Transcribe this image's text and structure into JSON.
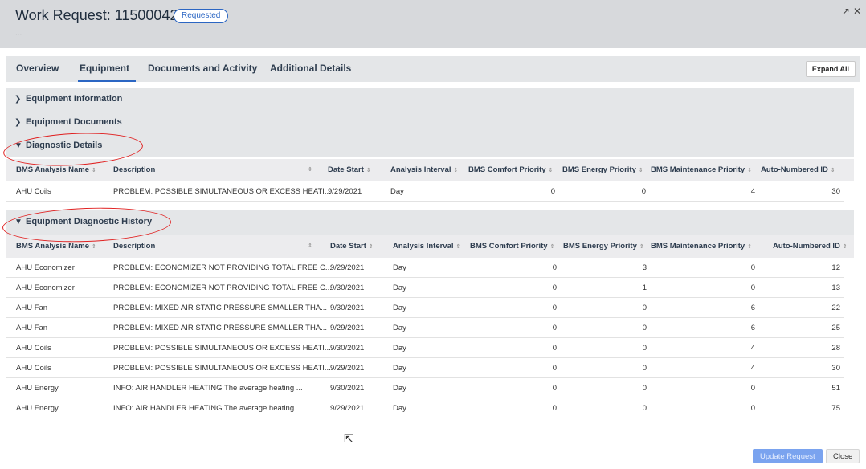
{
  "header": {
    "title": "Work Request: 1150004225",
    "status": "Requested",
    "subtitle": "...",
    "expand_icon": "↗",
    "close_icon": "✕"
  },
  "tabs": {
    "overview": "Overview",
    "equipment": "Equipment",
    "documents": "Documents and Activity",
    "additional": "Additional Details",
    "expand_all": "Expand All"
  },
  "sections": {
    "equipment_information": "Equipment Information",
    "equipment_documents": "Equipment Documents",
    "diagnostic_details": "Diagnostic Details",
    "diagnostic_history": "Equipment Diagnostic History"
  },
  "columns": {
    "name": "BMS Analysis Name",
    "description": "Description",
    "date_start": "Date Start",
    "interval": "Analysis Interval",
    "comfort": "BMS Comfort Priority",
    "energy": "BMS Energy Priority",
    "maintenance": "BMS Maintenance Priority",
    "id": "Auto-Numbered ID",
    "sort_icon": "⇕"
  },
  "diagnostic_rows": [
    {
      "name": "AHU Coils",
      "description": "PROBLEM: POSSIBLE SIMULTANEOUS OR EXCESS HEATI...",
      "date": "9/29/2021",
      "interval": "Day",
      "comfort": "0",
      "energy": "0",
      "maintenance": "4",
      "id": "30"
    }
  ],
  "history_rows": [
    {
      "name": "AHU Economizer",
      "description": "PROBLEM: ECONOMIZER NOT PROVIDING TOTAL FREE C...",
      "date": "9/29/2021",
      "interval": "Day",
      "comfort": "0",
      "energy": "3",
      "maintenance": "0",
      "id": "12"
    },
    {
      "name": "AHU Economizer",
      "description": "PROBLEM: ECONOMIZER NOT PROVIDING TOTAL FREE C...",
      "date": "9/30/2021",
      "interval": "Day",
      "comfort": "0",
      "energy": "1",
      "maintenance": "0",
      "id": "13"
    },
    {
      "name": "AHU Fan",
      "description": "PROBLEM: MIXED AIR STATIC PRESSURE SMALLER THA...",
      "date": "9/30/2021",
      "interval": "Day",
      "comfort": "0",
      "energy": "0",
      "maintenance": "6",
      "id": "22"
    },
    {
      "name": "AHU Fan",
      "description": "PROBLEM: MIXED AIR STATIC PRESSURE SMALLER THA...",
      "date": "9/29/2021",
      "interval": "Day",
      "comfort": "0",
      "energy": "0",
      "maintenance": "6",
      "id": "25"
    },
    {
      "name": "AHU Coils",
      "description": "PROBLEM: POSSIBLE SIMULTANEOUS OR EXCESS HEATI...",
      "date": "9/30/2021",
      "interval": "Day",
      "comfort": "0",
      "energy": "0",
      "maintenance": "4",
      "id": "28"
    },
    {
      "name": "AHU Coils",
      "description": "PROBLEM: POSSIBLE SIMULTANEOUS OR EXCESS HEATI...",
      "date": "9/29/2021",
      "interval": "Day",
      "comfort": "0",
      "energy": "0",
      "maintenance": "4",
      "id": "30"
    },
    {
      "name": "AHU Energy",
      "description": "INFO: AIR HANDLER HEATING The average heating ...",
      "date": "9/30/2021",
      "interval": "Day",
      "comfort": "0",
      "energy": "0",
      "maintenance": "0",
      "id": "51"
    },
    {
      "name": "AHU Energy",
      "description": "INFO: AIR HANDLER HEATING The average heating ...",
      "date": "9/29/2021",
      "interval": "Day",
      "comfort": "0",
      "energy": "0",
      "maintenance": "0",
      "id": "75"
    }
  ],
  "footer": {
    "update": "Update Request",
    "close": "Close"
  },
  "colors": {
    "accent": "#2b66c3",
    "annotation": "#e02020"
  }
}
